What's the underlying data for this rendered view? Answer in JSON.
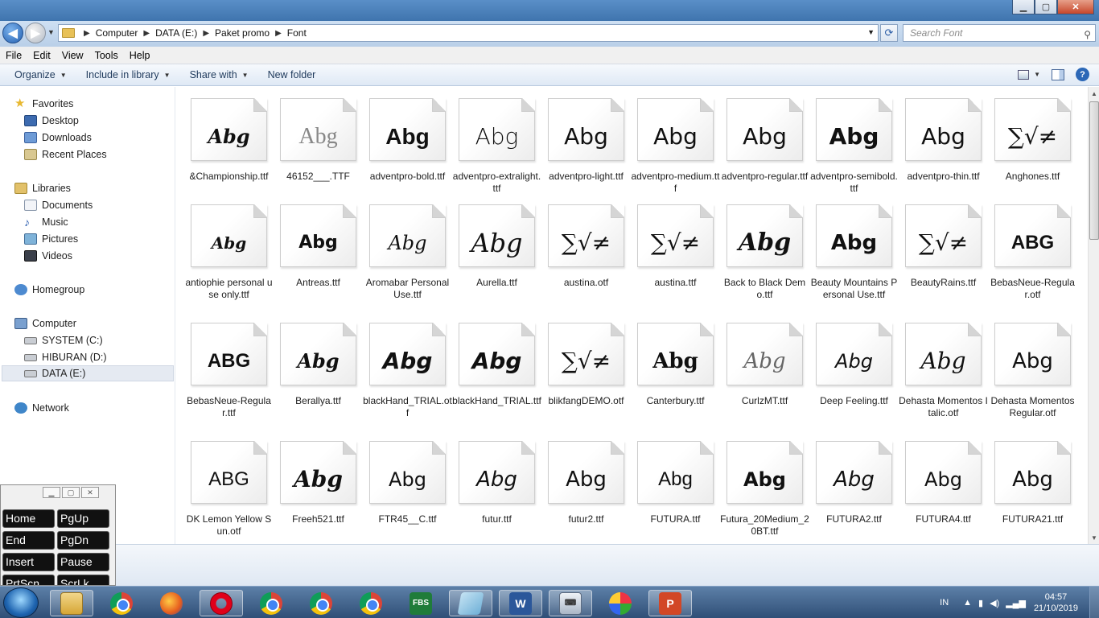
{
  "window": {
    "controls": [
      "minimize",
      "maximize",
      "close"
    ]
  },
  "address": {
    "breadcrumb": [
      "Computer",
      "DATA (E:)",
      "Paket promo",
      "Font"
    ],
    "search_placeholder": "Search Font"
  },
  "menu": [
    "File",
    "Edit",
    "View",
    "Tools",
    "Help"
  ],
  "commands": {
    "organize": "Organize",
    "include": "Include in library",
    "share": "Share with",
    "newfolder": "New folder"
  },
  "nav": {
    "favorites": "Favorites",
    "desktop": "Desktop",
    "downloads": "Downloads",
    "recent": "Recent Places",
    "libraries": "Libraries",
    "documents": "Documents",
    "music": "Music",
    "pictures": "Pictures",
    "videos": "Videos",
    "homegroup": "Homegroup",
    "computer": "Computer",
    "drive_c": "SYSTEM (C:)",
    "drive_d": "HIBURAN (D:)",
    "drive_e": "DATA (E:)",
    "network": "Network"
  },
  "files": [
    {
      "name": "&Championship.ttf",
      "sample": "Abg"
    },
    {
      "name": "46152___.TTF",
      "sample": "Abg"
    },
    {
      "name": "adventpro-bold.ttf",
      "sample": "Abg"
    },
    {
      "name": "adventpro-extralight.ttf",
      "sample": "Abg"
    },
    {
      "name": "adventpro-light.ttf",
      "sample": "Abg"
    },
    {
      "name": "adventpro-medium.ttf",
      "sample": "Abg"
    },
    {
      "name": "adventpro-regular.ttf",
      "sample": "Abg"
    },
    {
      "name": "adventpro-semibold.ttf",
      "sample": "Abg"
    },
    {
      "name": "adventpro-thin.ttf",
      "sample": "Abg"
    },
    {
      "name": "Anghones.ttf",
      "sample": "∑√≠"
    },
    {
      "name": "antiophie personal use only.ttf",
      "sample": "Abg"
    },
    {
      "name": "Antreas.ttf",
      "sample": "Abg"
    },
    {
      "name": "Aromabar Personal Use.ttf",
      "sample": "Abg"
    },
    {
      "name": "Aurella.ttf",
      "sample": "Abg"
    },
    {
      "name": "austina.otf",
      "sample": "∑√≠"
    },
    {
      "name": "austina.ttf",
      "sample": "∑√≠"
    },
    {
      "name": "Back to Black Demo.ttf",
      "sample": "Abg"
    },
    {
      "name": "Beauty Mountains Personal Use.ttf",
      "sample": "Abg"
    },
    {
      "name": "BeautyRains.ttf",
      "sample": "∑√≠"
    },
    {
      "name": "BebasNeue-Regular.otf",
      "sample": "ABG"
    },
    {
      "name": "BebasNeue-Regular.ttf",
      "sample": "ABG"
    },
    {
      "name": "Berallya.ttf",
      "sample": "Abg"
    },
    {
      "name": "blackHand_TRIAL.otf",
      "sample": "Abg"
    },
    {
      "name": "blackHand_TRIAL.ttf",
      "sample": "Abg"
    },
    {
      "name": "blikfangDEMO.otf",
      "sample": "∑√≠"
    },
    {
      "name": "Canterbury.ttf",
      "sample": "Abg"
    },
    {
      "name": "CurlzMT.ttf",
      "sample": "Abg"
    },
    {
      "name": "Deep Feeling.ttf",
      "sample": "Abg"
    },
    {
      "name": "Dehasta Momentos Italic.otf",
      "sample": "Abg"
    },
    {
      "name": "Dehasta Momentos Regular.otf",
      "sample": "Abg"
    },
    {
      "name": "DK Lemon Yellow Sun.otf",
      "sample": "ABG"
    },
    {
      "name": "Freeh521.ttf",
      "sample": "Abg"
    },
    {
      "name": "FTR45__C.ttf",
      "sample": "Abg"
    },
    {
      "name": "futur.ttf",
      "sample": "Abg"
    },
    {
      "name": "futur2.ttf",
      "sample": "Abg"
    },
    {
      "name": "FUTURA.ttf",
      "sample": "Abg"
    },
    {
      "name": "Futura_20Medium_20BT.ttf",
      "sample": "Abg"
    },
    {
      "name": "FUTURA2.ttf",
      "sample": "Abg"
    },
    {
      "name": "FUTURA4.ttf",
      "sample": "Abg"
    },
    {
      "name": "FUTURA21.ttf",
      "sample": "Abg"
    }
  ],
  "osk": {
    "keys": [
      "Home",
      "PgUp",
      "End",
      "PgDn",
      "Insert",
      "Pause",
      "PrtScn",
      "ScrLk"
    ]
  },
  "taskbar": {
    "apps": [
      "Windows Explorer",
      "Google Chrome",
      "Firefox",
      "Opera",
      "Google Chrome",
      "Google Chrome",
      "Google Chrome",
      "FBS",
      "Sticky Notes",
      "Word",
      "On-Screen Keyboard",
      "Paint",
      "PowerPoint"
    ],
    "fbs_label": "FBS",
    "word_label": "W",
    "ppt_label": "P",
    "lang": "IN",
    "time": "04:57",
    "date": "21/10/2019"
  }
}
